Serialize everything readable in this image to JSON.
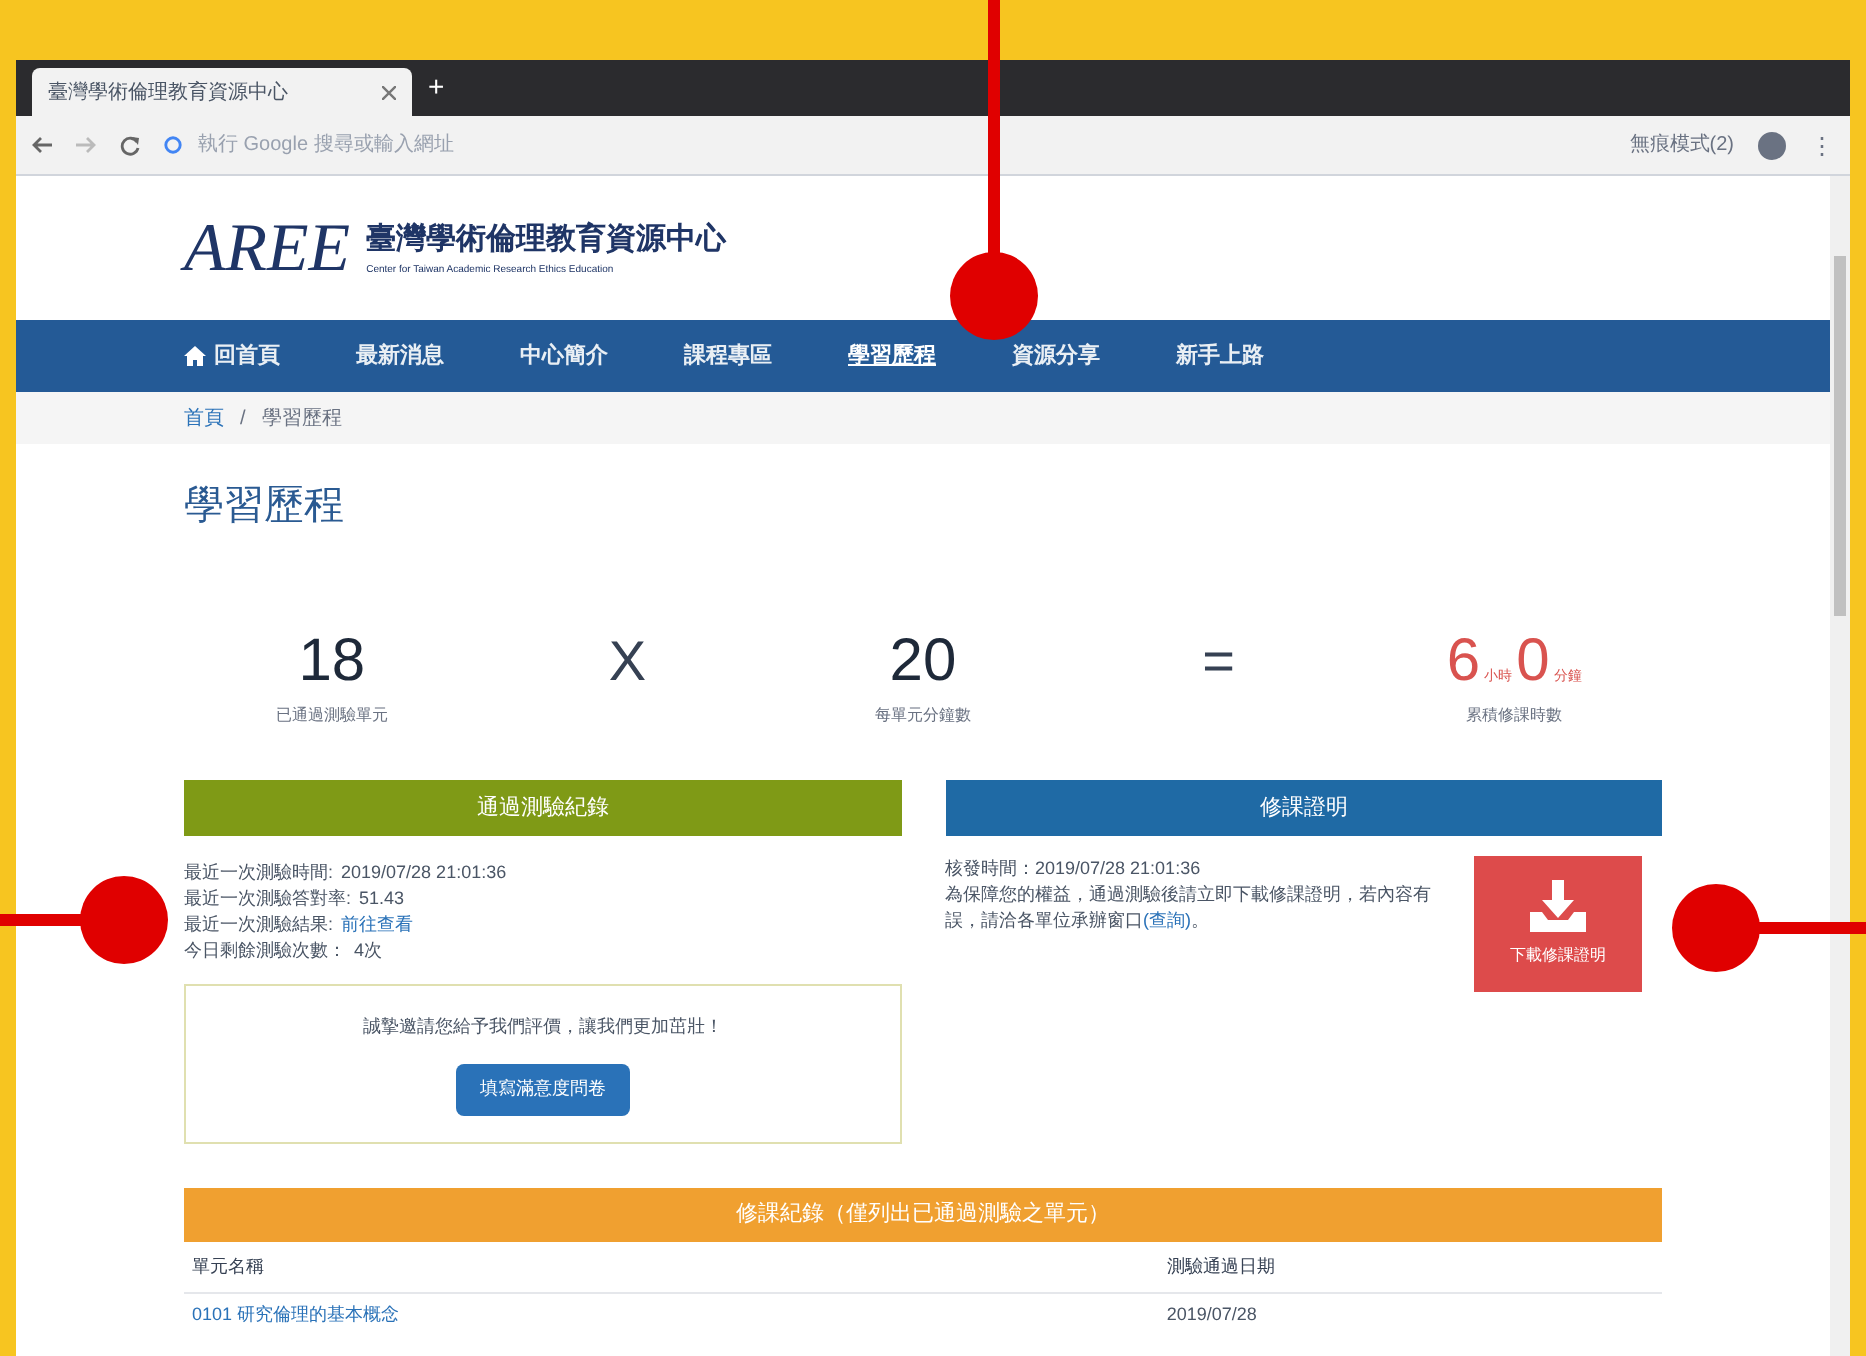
{
  "browser": {
    "tab_title": "臺灣學術倫理教育資源中心",
    "new_tab": "+",
    "address_placeholder": "執行 Google 搜尋或輸入網址",
    "incognito": "無痕模式(2)",
    "menu": "⋮"
  },
  "site": {
    "logo": "AREE",
    "name": "臺灣學術倫理教育資源中心",
    "subtitle": "Center for Taiwan Academic Research Ethics Education"
  },
  "nav": [
    {
      "label": "回首頁",
      "kind": "home",
      "selected": false
    },
    {
      "label": "最新消息",
      "kind": "text",
      "selected": false
    },
    {
      "label": "中心簡介",
      "kind": "text",
      "selected": false
    },
    {
      "label": "課程專區",
      "kind": "text",
      "selected": false
    },
    {
      "label": "學習歷程",
      "kind": "text",
      "selected": true
    },
    {
      "label": "資源分享",
      "kind": "text",
      "selected": false
    },
    {
      "label": "新手上路",
      "kind": "text",
      "selected": false
    }
  ],
  "breadcrumb": [
    "首頁",
    "學習歷程"
  ],
  "breadcrumb_separator": "/",
  "page_title": "學習歷程",
  "stats": [
    {
      "value": "18",
      "caption": "已通過測驗單元",
      "kind": "number"
    },
    {
      "value": "X",
      "kind": "operator"
    },
    {
      "value": "20",
      "caption": "每單元分鐘數",
      "kind": "number"
    },
    {
      "value": "=",
      "kind": "operator"
    },
    {
      "hours": "6",
      "hours_unit": "小時",
      "minutes": "0",
      "minutes_unit": "分鐘",
      "caption": "累積修課時數",
      "kind": "time"
    }
  ],
  "test_record": {
    "title": "通過測驗紀錄",
    "lines": [
      {
        "label": "最近一次測驗時間:",
        "value": "2019/07/28 21:01:36",
        "kind": "text"
      },
      {
        "label": "最近一次測驗答對率:",
        "value": "51.43",
        "kind": "text"
      },
      {
        "label": "最近一次測驗結果:",
        "value": "前往查看",
        "kind": "link"
      },
      {
        "label": "今日剩餘測驗次數：",
        "value": "4次",
        "kind": "text"
      }
    ],
    "survey_text": "誠摯邀請您給予我們評價，讓我們更加茁壯！",
    "survey_button": "填寫滿意度問卷"
  },
  "certificate": {
    "title": "修課證明",
    "issued": "核發時間：2019/07/28 21:01:36",
    "note": "為保障您的權益，通過測驗後請立即下載修課證明，若內容有誤，請洽各單位承辦窗口",
    "note_link": "(查詢)",
    "note_end": "。",
    "download_button": "下載修課證明"
  },
  "table": {
    "title": "修課紀錄（僅列出已通過測驗之單元）",
    "columns": [
      "單元名稱",
      "測驗通過日期"
    ],
    "rows": [
      {
        "name": "0101 研究倫理的基本概念",
        "date": "2019/07/28"
      }
    ]
  }
}
